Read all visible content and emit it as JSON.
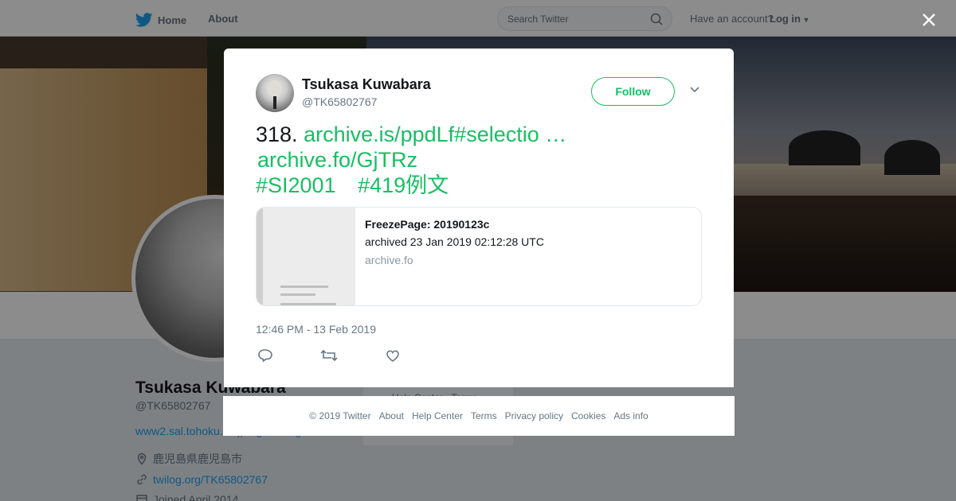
{
  "topnav": {
    "home_label": "Home",
    "about_label": "About",
    "search_placeholder": "Search Twitter",
    "have_account": "Have an account?",
    "login_label": "Log in"
  },
  "profile": {
    "name": "Tsukasa Kuwabara",
    "handle": "@TK65802767",
    "url": "www2.sal.tohoku.ac.jp/~gothic/agh",
    "location": "鹿児島県鹿児島市",
    "link": "twilog.org/TK65802767",
    "joined": "Joined April 2014",
    "side_text": "Help Center · Terms"
  },
  "tweet": {
    "author_name": "Tsukasa Kuwabara",
    "author_handle": "@TK65802767",
    "follow_label": "Follow",
    "number": "318.",
    "link1": "archive.is/ppdLf#selectio …",
    "link2": "archive.fo/GjTRz",
    "hashtag1": "#SI2001",
    "hashtag2": "#419例文",
    "card": {
      "title": "FreezePage: 20190123c",
      "description": "archived 23 Jan 2019 02:12:28 UTC",
      "domain": "archive.fo"
    },
    "timestamp": "12:46 PM - 13 Feb 2019"
  },
  "footer": {
    "links": [
      "© 2019 Twitter",
      "About",
      "Help Center",
      "Terms",
      "Privacy policy",
      "Cookies",
      "Ads info"
    ]
  },
  "colors": {
    "accent": "#17bf63",
    "link_blue": "#1da1f2",
    "muted": "#657786",
    "text": "#14171a"
  },
  "icons": [
    "twitter-bird-icon",
    "search-icon",
    "caret-down-icon",
    "close-icon",
    "chevron-down-icon",
    "reply-icon",
    "retweet-icon",
    "heart-icon",
    "location-icon",
    "link-icon",
    "calendar-icon"
  ]
}
